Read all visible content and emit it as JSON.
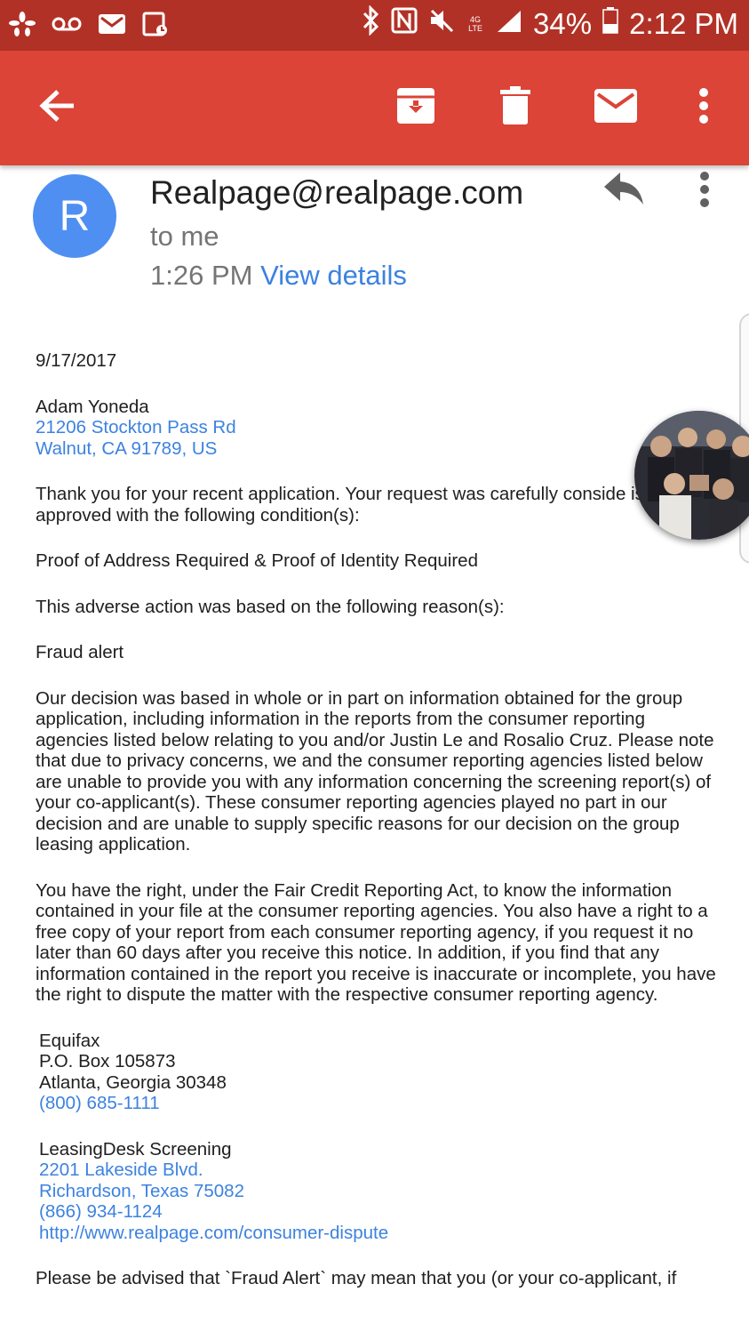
{
  "status_bar": {
    "battery": "34%",
    "time": "2:12 PM",
    "network": "4G LTE",
    "left_icons": [
      "yelp-icon",
      "voicemail-icon",
      "gmail-icon",
      "calendar-icon"
    ],
    "right_icons": [
      "bluetooth-icon",
      "nfc-icon",
      "mute-icon",
      "signal-icon",
      "battery-icon"
    ]
  },
  "toolbar": {
    "back_icon": "arrow-left-icon",
    "archive_icon": "archive-icon",
    "delete_icon": "trash-icon",
    "mark_unread_icon": "mail-icon",
    "more_icon": "more-vertical-icon",
    "color": "#db4437"
  },
  "message": {
    "avatar_letter": "R",
    "avatar_color": "#4f8ff2",
    "sender": "Realpage@realpage.com",
    "recipient": "to me",
    "time": "1:26 PM",
    "view_details": "View details",
    "reply_icon": "reply-icon",
    "more_icon": "more-vertical-icon"
  },
  "body": {
    "date": "9/17/2017",
    "name": "Adam Yoneda",
    "address1": "21206 Stockton Pass Rd",
    "address2": "Walnut, CA 91789, US",
    "para1": "Thank you for your recent application. Your request was carefully conside is approved with the following condition(s):",
    "conditions": "Proof of Address Required & Proof of Identity Required",
    "reasons_intro": "This adverse action was based on the following reason(s):",
    "reason": "Fraud alert",
    "para2": "Our decision was based in whole or in part on information obtained for the group application, including information in the reports from the consumer reporting agencies listed below relating to you and/or Justin Le and Rosalio Cruz. Please note that due to privacy concerns, we and the consumer reporting agencies listed below are unable to provide you with any information concerning the screening report(s) of your co-applicant(s). These consumer reporting agencies played no part in our decision and are unable to supply specific reasons for our decision on the group leasing application.",
    "para3": "You have the right, under the Fair Credit Reporting Act, to know the information contained in your file at the consumer reporting agencies. You also have a right to a free copy of your report from each consumer reporting agency, if you request it no later than 60 days after you receive this notice. In addition, if you find that any information contained in the report you receive is inaccurate or incomplete, you have the right to dispute the matter with the respective consumer reporting agency.",
    "equifax": {
      "name": "Equifax",
      "line1": "P.O. Box 105873",
      "line2": "Atlanta, Georgia 30348",
      "phone": "(800) 685-1111"
    },
    "leasingdesk": {
      "name": "LeasingDesk Screening",
      "line1": "2201 Lakeside Blvd.",
      "line2": "Richardson, Texas 75082",
      "phone": "(866) 934-1124",
      "url": "http://www.realpage.com/consumer-dispute"
    },
    "para4": "Please be advised that `Fraud Alert` may mean that you (or your co-applicant, if"
  },
  "chat_head": {
    "icon": "chat-head-photo"
  }
}
